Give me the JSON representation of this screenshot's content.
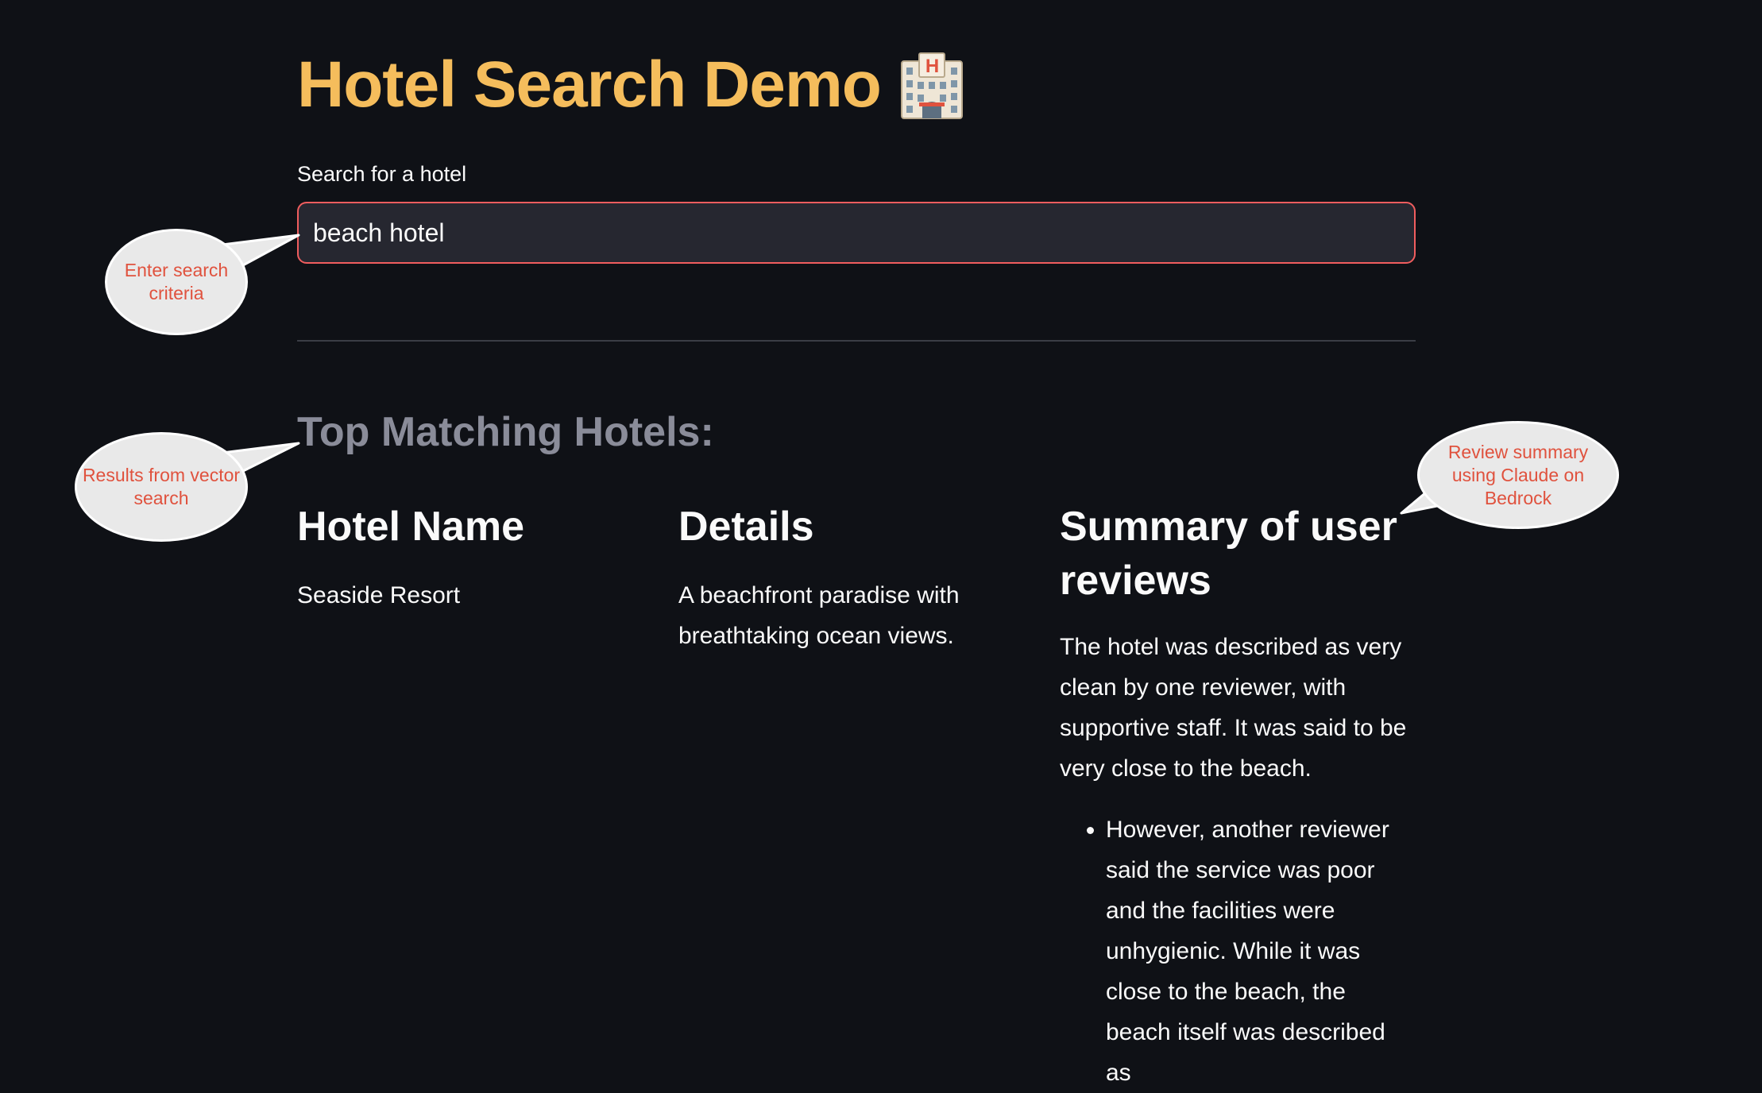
{
  "header": {
    "title": "Hotel Search Demo",
    "title_color": "#f5bd5c",
    "icon": "hotel-icon"
  },
  "search": {
    "label": "Search for a hotel",
    "value": "beach hotel",
    "border_color": "#f05d5e"
  },
  "results": {
    "section_title": "Top Matching Hotels:",
    "columns": [
      {
        "heading": "Hotel Name",
        "text": "Seaside Resort"
      },
      {
        "heading": "Details",
        "text": "A beachfront paradise with breathtaking ocean views."
      },
      {
        "heading": "Summary of user reviews",
        "text": "The hotel was described as very clean by one reviewer, with supportive staff. It was said to be very close to the beach.",
        "bullets": [
          "However, another reviewer said the service was poor and the facilities were unhygienic. While it was close to the beach, the beach itself was described as"
        ]
      }
    ]
  },
  "annotations": {
    "search_callout": "Enter search criteria",
    "results_callout": "Results from vector search",
    "summary_callout": "Review summary using Claude on Bedrock",
    "callout_text_color": "#e0523e"
  }
}
